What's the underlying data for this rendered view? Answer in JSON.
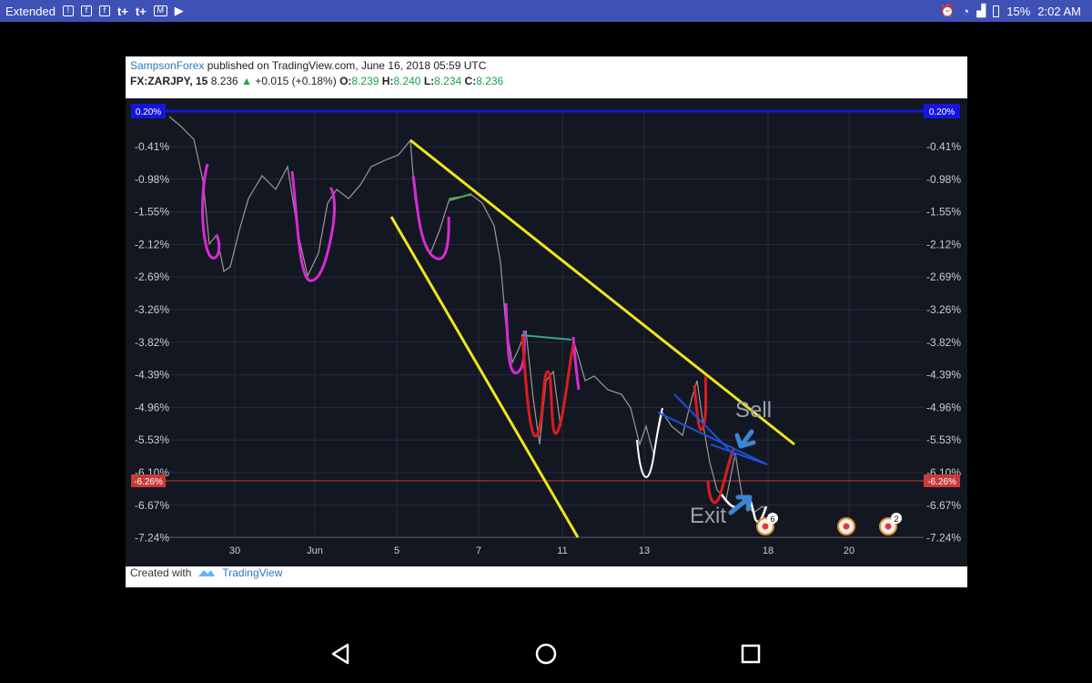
{
  "status_bar": {
    "left_label": "Extended",
    "battery": "15%",
    "time": "2:02 AM",
    "icons": [
      "alert-icon",
      "flipboard-icon",
      "flipboard-icon",
      "tplus-icon",
      "tplus-icon",
      "gmail-icon",
      "play-icon",
      "alarm-icon",
      "wifi-icon",
      "signal-icon",
      "battery-icon"
    ]
  },
  "header": {
    "publisher": "SampsonForex",
    "published_text": "published on TradingView.com, June 16, 2018 05:59 UTC",
    "symbol": "FX:ZARJPY, 15",
    "last": "8.236",
    "change": "+0.015 (+0.18%)",
    "open_label": "O:",
    "open": "8.239",
    "high_label": "H:",
    "high": "8.240",
    "low_label": "L:",
    "low": "8.234",
    "close_label": "C:",
    "close": "8.236"
  },
  "chart": {
    "y_ticks": [
      "-0.41%",
      "-0.98%",
      "-1.55%",
      "-2.12%",
      "-2.69%",
      "-3.26%",
      "-3.82%",
      "-4.39%",
      "-4.96%",
      "-5.53%",
      "-6.10%",
      "-6.67%",
      "-7.24%"
    ],
    "x_ticks": [
      "30",
      "Jun",
      "5",
      "7",
      "11",
      "13",
      "18",
      "20"
    ],
    "top_label": "0.20%",
    "current_label": "-6.26%",
    "annotations": {
      "sell": "Sell",
      "exit": "Exit"
    },
    "event_badges": [
      "6",
      "",
      "2"
    ],
    "colors": {
      "background": "#131722",
      "trend": "#f0e51c",
      "cup": "#d72bd4",
      "red": "#d91e1e",
      "white": "#ffffff",
      "blue": "#1d4fd8",
      "top_line": "#1515e0",
      "current_line": "#c73b3b"
    }
  },
  "footer": {
    "created_with": "Created with",
    "brand": "TradingView"
  },
  "nav": {
    "back": "back-icon",
    "home": "home-icon",
    "recents": "recents-icon"
  }
}
